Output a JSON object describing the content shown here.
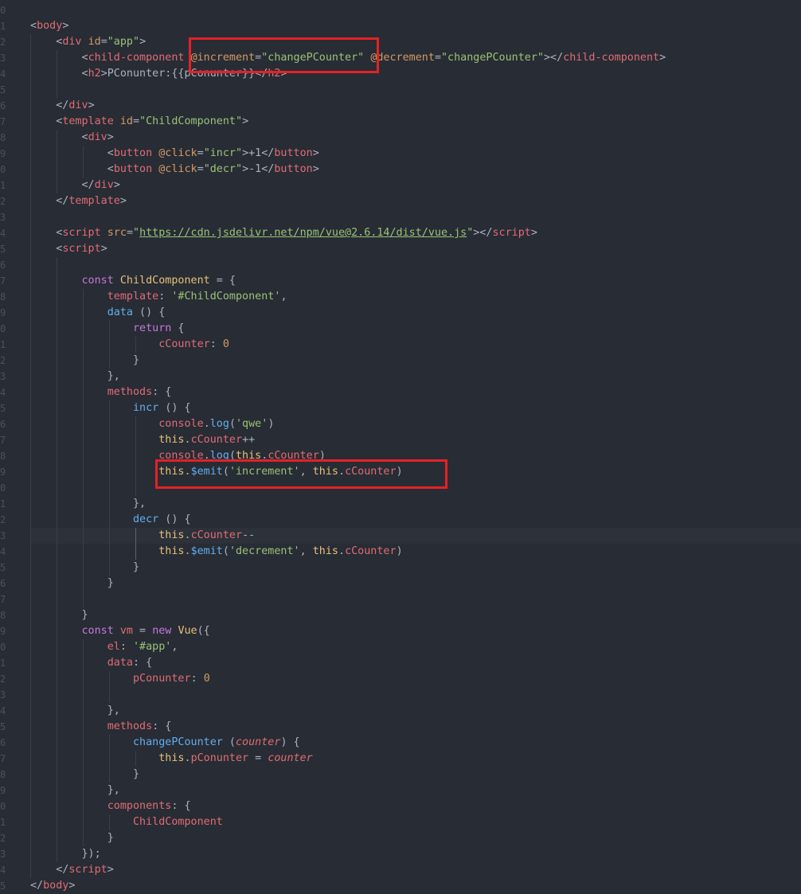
{
  "editor": {
    "gutter_numbers": [
      "0",
      "1",
      "2",
      "3",
      "4",
      "5",
      "6",
      "7",
      "8",
      "9",
      "0",
      "1",
      "2",
      "3",
      "4",
      "5",
      "6",
      "7",
      "8",
      "9",
      "0",
      "1",
      "2",
      "3",
      "4",
      "5",
      "6",
      "7",
      "8",
      "9",
      "0",
      "1",
      "2",
      "3",
      "4",
      "5",
      "6",
      "7",
      "8",
      "9",
      "0",
      "1",
      "2",
      "3",
      "4",
      "5",
      "6",
      "7",
      "8",
      "9",
      "0",
      "1",
      "2",
      "3",
      "4",
      "5"
    ],
    "code": {
      "body_open": "body",
      "div_tag": "div",
      "id_attr": "id",
      "app_id": "\"app\"",
      "child_component_tag": "child-component",
      "increment_attr": "@increment",
      "change_handler": "\"changePCounter\"",
      "decrement_attr": "@decrement",
      "h2_tag": "h2",
      "h2_text": "PConunter:{{pConunter}}",
      "template_tag": "template",
      "child_template_id": "\"ChildComponent\"",
      "button_tag": "button",
      "click_attr": "@click",
      "incr_handler": "\"incr\"",
      "plus_label": "+1",
      "decr_handler": "\"decr\"",
      "minus_label": "-1",
      "script_tag": "script",
      "src_attr": "src",
      "script_src_url": "https://cdn.jsdelivr.net/npm/vue@2.6.14/dist/vue.js",
      "kw_const": "const",
      "child_component_name": "ChildComponent",
      "template_key": "template",
      "template_value": "'#ChildComponent'",
      "data_key": "data",
      "kw_return": "return",
      "ccounter_key": "cCounter",
      "zero": "0",
      "methods_key": "methods",
      "incr_name": "incr",
      "console": "console",
      "log": "log",
      "qwe_string": "'qwe'",
      "kw_this": "this",
      "ccounter": "cCounter",
      "emit": "$emit",
      "increment_string": "'increment'",
      "decr_name": "decr",
      "decrement_string": "'decrement'",
      "vm": "vm",
      "kw_new": "new",
      "vue": "Vue",
      "el_key": "el",
      "app_selector": "'#app'",
      "pconunter_key": "pConunter",
      "change_pcounter": "changePCounter",
      "counter_param": "counter",
      "pconunter": "pConunter",
      "components_key": "components"
    }
  }
}
